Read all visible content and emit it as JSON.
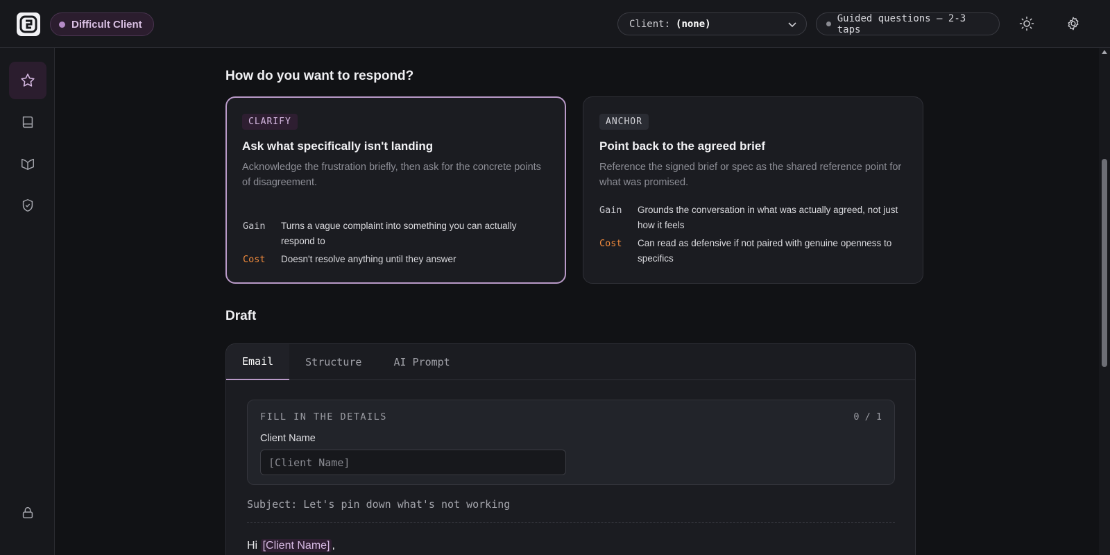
{
  "header": {
    "mode_label": "Difficult Client",
    "client_select": {
      "label": "Client:",
      "value": "(none)"
    },
    "guided_label": "Guided questions — 2-3 taps"
  },
  "respond": {
    "title": "How do you want to respond?",
    "options": [
      {
        "tag": "CLARIFY",
        "title": "Ask what specifically isn't landing",
        "description": "Acknowledge the frustration briefly, then ask for the concrete points of disagreement.",
        "gain_label": "Gain",
        "gain": "Turns a vague complaint into something you can actually respond to",
        "cost_label": "Cost",
        "cost": "Doesn't resolve anything until they answer",
        "selected": true
      },
      {
        "tag": "ANCHOR",
        "title": "Point back to the agreed brief",
        "description": "Reference the signed brief or spec as the shared reference point for what was promised.",
        "gain_label": "Gain",
        "gain": "Grounds the conversation in what was actually agreed, not just how it feels",
        "cost_label": "Cost",
        "cost": "Can read as defensive if not paired with genuine openness to specifics",
        "selected": false
      }
    ]
  },
  "draft": {
    "title": "Draft",
    "tabs": [
      "Email",
      "Structure",
      "AI Prompt"
    ],
    "active_tab": "Email",
    "fill": {
      "heading": "FILL IN THE DETAILS",
      "count": "0 / 1",
      "field_label": "Client Name",
      "field_placeholder": "[Client Name]"
    },
    "subject": "Subject: Let's pin down what's not working",
    "greeting_prefix": "Hi",
    "greeting_placeholder": "[Client Name]",
    "greeting_suffix": ","
  },
  "colors": {
    "accent": "#b99ac8",
    "cost": "#f08a3c",
    "background": "#111215"
  }
}
